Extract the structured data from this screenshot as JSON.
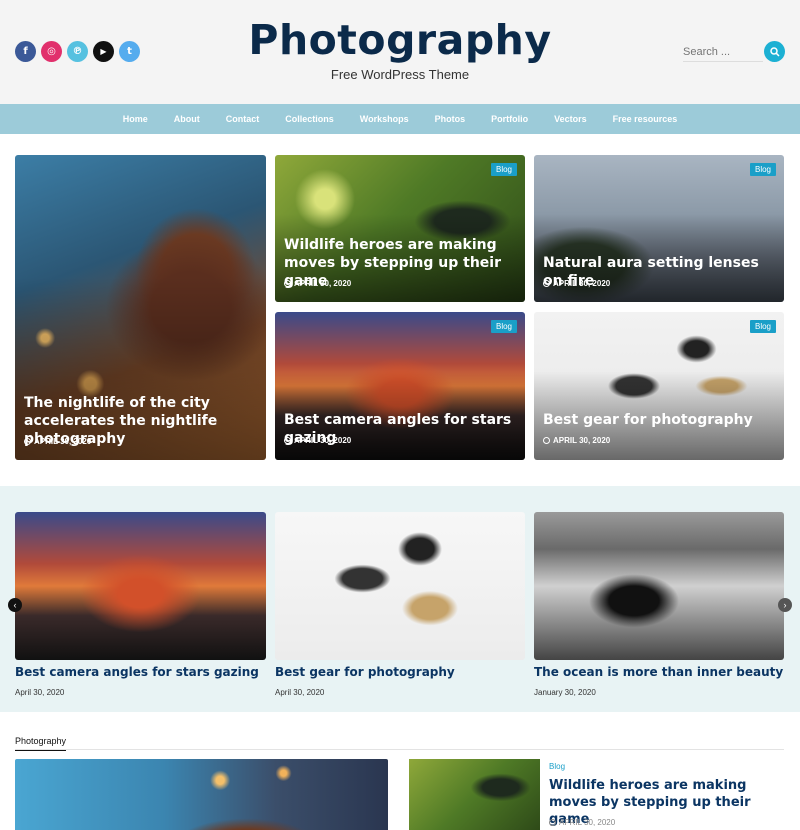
{
  "header": {
    "title": "Photography",
    "tagline": "Free WordPress Theme",
    "socials": [
      {
        "name": "facebook-icon",
        "glyph": "f",
        "color": "#3b5998"
      },
      {
        "name": "instagram-icon",
        "glyph": "◎",
        "color": "#e1306c"
      },
      {
        "name": "pinterest-icon",
        "glyph": "℗",
        "color": "#56c1e0"
      },
      {
        "name": "youtube-icon",
        "glyph": "▶",
        "color": "#111111"
      },
      {
        "name": "twitter-icon",
        "glyph": "t",
        "color": "#55acee"
      }
    ],
    "search": {
      "placeholder": "Search ..."
    }
  },
  "nav": {
    "items": [
      "Home",
      "About",
      "Contact",
      "Collections",
      "Workshops",
      "Photos",
      "Portfolio",
      "Vectors",
      "Free resources"
    ]
  },
  "hero": {
    "badge": "Blog",
    "cards": [
      {
        "title": "The nightlife of the city accelerates the nightlife photography",
        "date": "APRIL 30, 2020"
      },
      {
        "title": "Wildlife heroes are making moves by stepping up their game",
        "date": "APRIL 30, 2020"
      },
      {
        "title": "Natural aura setting lenses on fire",
        "date": "APRIL 30, 2020"
      },
      {
        "title": "Best camera angles for stars gazing",
        "date": "APRIL 30, 2020"
      },
      {
        "title": "Best gear for photography",
        "date": "APRIL 30, 2020"
      }
    ]
  },
  "slider": {
    "slides": [
      {
        "title": "Best camera angles for stars gazing",
        "date": "April 30, 2020"
      },
      {
        "title": "Best gear for photography",
        "date": "April 30, 2020"
      },
      {
        "title": "The ocean is more than inner beauty",
        "date": "January 30, 2020"
      }
    ],
    "prev": "‹",
    "next": "›"
  },
  "section": {
    "tab": "Photography",
    "side_post": {
      "category": "Blog",
      "title": "Wildlife heroes are making moves by stepping up their game",
      "date": "APRIL 30, 2020"
    }
  },
  "colors": {
    "accent": "#1cb0d3",
    "nav": "#9ccbd9",
    "title": "#0b2a4a",
    "badge": "#1a9fc8"
  }
}
